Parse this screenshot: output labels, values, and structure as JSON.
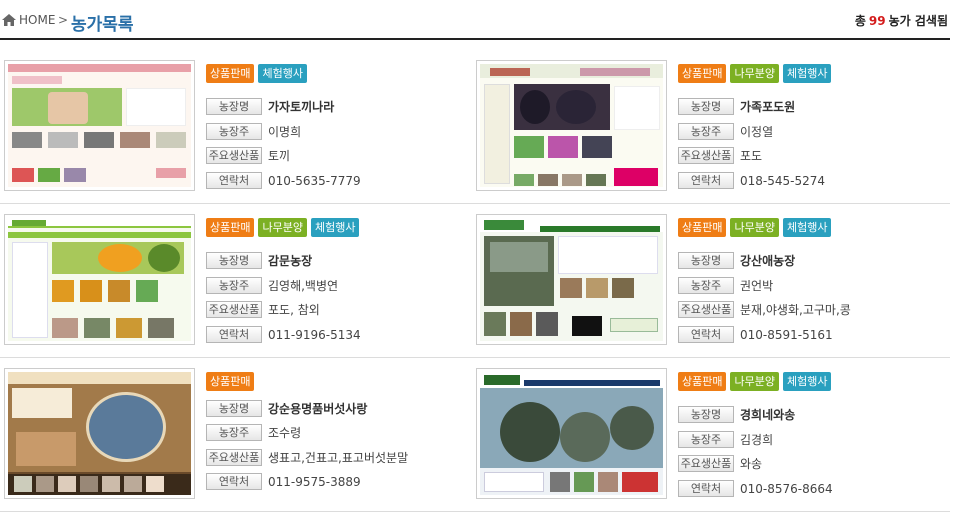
{
  "header": {
    "home_label": "HOME",
    "separator": ">",
    "title": "농가목록",
    "count_prefix": "총",
    "count": "99",
    "count_suffix": "농가 검색됨"
  },
  "labels": {
    "name": "농장명",
    "owner": "농장주",
    "product": "주요생산품",
    "contact": "연락처"
  },
  "badges": {
    "sale": "상품판매",
    "tree": "나무분양",
    "experience": "체험행사"
  },
  "farms": [
    {
      "name": "가자토끼나라",
      "owner": "이명희",
      "product": "토끼",
      "contact": "010-5635-7779"
    },
    {
      "name": "가족포도원",
      "owner": "이정열",
      "product": "포도",
      "contact": "018-545-5274"
    },
    {
      "name": "감문농장",
      "owner": "김영해,백병연",
      "product": "포도, 참외",
      "contact": "011-9196-5134"
    },
    {
      "name": "강산애농장",
      "owner": "권언박",
      "product": "분재,야생화,고구마,콩",
      "contact": "010-8591-5161"
    },
    {
      "name": "강순용명품버섯사랑",
      "owner": "조수령",
      "product": "생표고,건표고,표고버섯분말",
      "contact": "011-9575-3889"
    },
    {
      "name": "경희네와송",
      "owner": "김경희",
      "product": "와송",
      "contact": "010-8576-8664"
    }
  ],
  "colors": {
    "title_blue": "#2a70a8",
    "count_red": "#d41c1c",
    "badge_sale": "#ef7d15",
    "badge_tree": "#7cb023",
    "badge_experience": "#2aa0bf"
  }
}
